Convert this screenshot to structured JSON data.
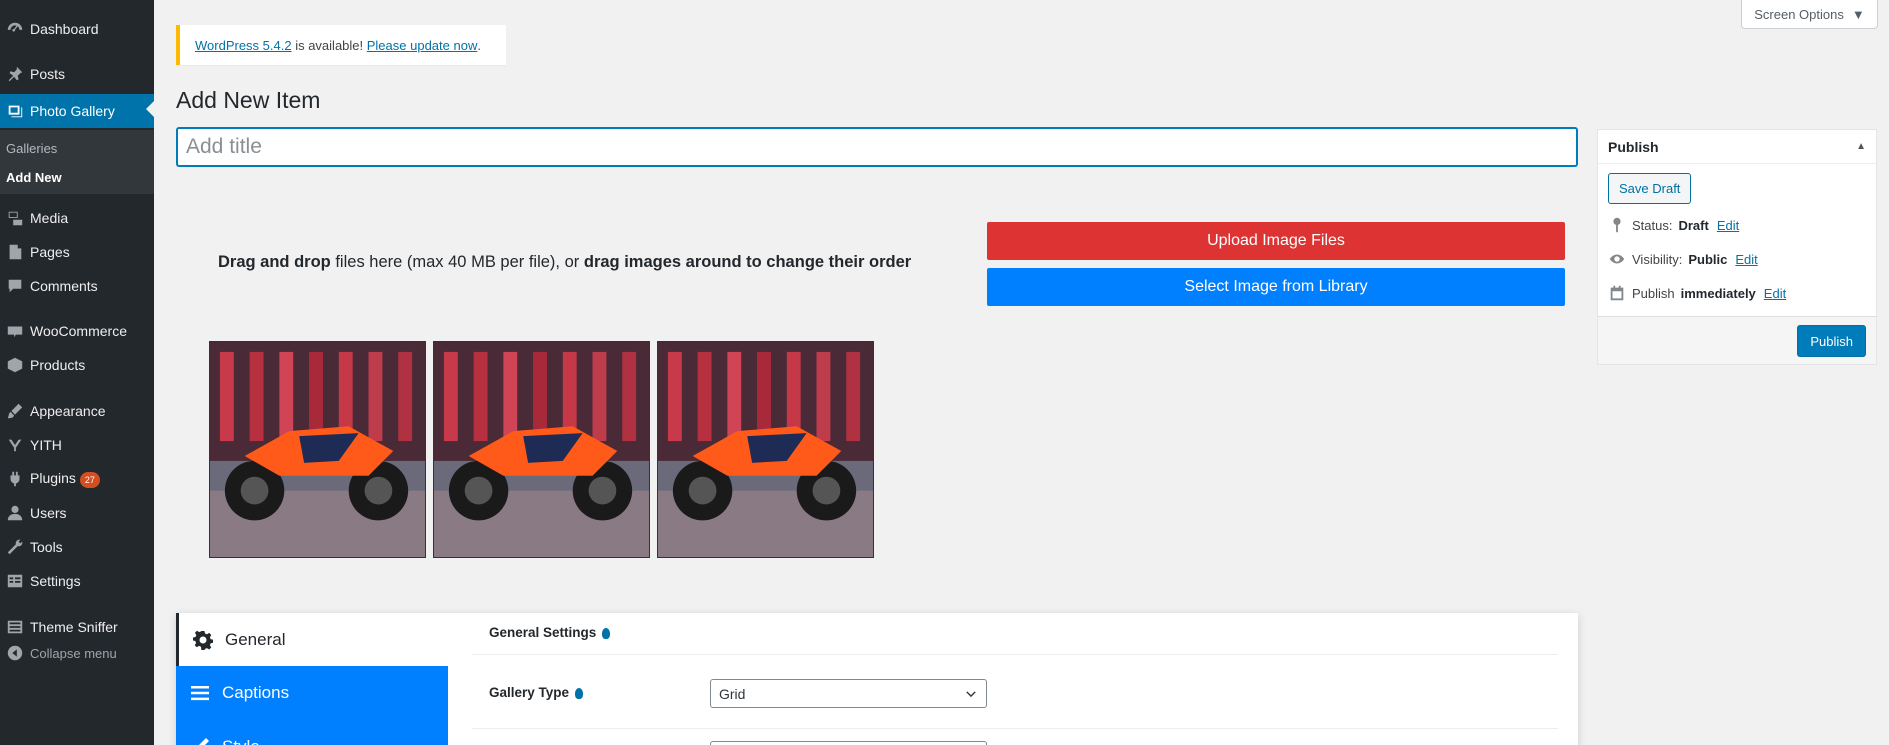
{
  "sidebar": {
    "items": [
      {
        "label": "Dashboard",
        "icon": "dashboard-icon"
      },
      {
        "label": "Posts",
        "icon": "pin-icon"
      },
      {
        "label": "Photo Gallery",
        "icon": "gallery-icon"
      },
      {
        "label": "Media",
        "icon": "media-icon"
      },
      {
        "label": "Pages",
        "icon": "pages-icon"
      },
      {
        "label": "Comments",
        "icon": "comments-icon"
      },
      {
        "label": "WooCommerce",
        "icon": "woocommerce-icon"
      },
      {
        "label": "Products",
        "icon": "products-icon"
      },
      {
        "label": "Appearance",
        "icon": "appearance-icon"
      },
      {
        "label": "YITH",
        "icon": "yith-icon"
      },
      {
        "label": "Plugins",
        "icon": "plugins-icon",
        "badge": "27"
      },
      {
        "label": "Users",
        "icon": "users-icon"
      },
      {
        "label": "Tools",
        "icon": "tools-icon"
      },
      {
        "label": "Settings",
        "icon": "settings-icon"
      },
      {
        "label": "Theme Sniffer",
        "icon": "theme-sniffer-icon"
      }
    ],
    "submenu": [
      "Galleries",
      "Add New"
    ],
    "collapse_label": "Collapse menu"
  },
  "notice": {
    "link1": "WordPress 5.4.2",
    "middle": " is available! ",
    "link2": "Please update now",
    "end": "."
  },
  "screen_options": "Screen Options",
  "page_title": "Add New Item",
  "title_placeholder": "Add title",
  "publish": {
    "heading": "Publish",
    "save_draft": "Save Draft",
    "status_label": "Status:",
    "status_value": "Draft",
    "visibility_label": "Visibility:",
    "visibility_value": "Public",
    "schedule_label": "Publish",
    "schedule_value": "immediately",
    "edit": "Edit",
    "publish_button": "Publish"
  },
  "uploader": {
    "dnd_bold1": "Drag and drop",
    "dnd_mid": " files here (max 40 MB per file), or ",
    "dnd_bold2": "drag images around to change their order",
    "upload_button": "Upload Image Files",
    "library_button": "Select Image from Library"
  },
  "settings": {
    "tabs": [
      "General",
      "Captions",
      "Style"
    ],
    "section_title": "General Settings",
    "gallery_type_label": "Gallery Type",
    "gallery_type_value": "Grid"
  },
  "colors": {
    "sidebar_bg": "#23282d",
    "accent": "#0073aa",
    "upload_red": "#dd3333",
    "library_blue": "#0080ff",
    "notice_border": "#ffb900"
  }
}
